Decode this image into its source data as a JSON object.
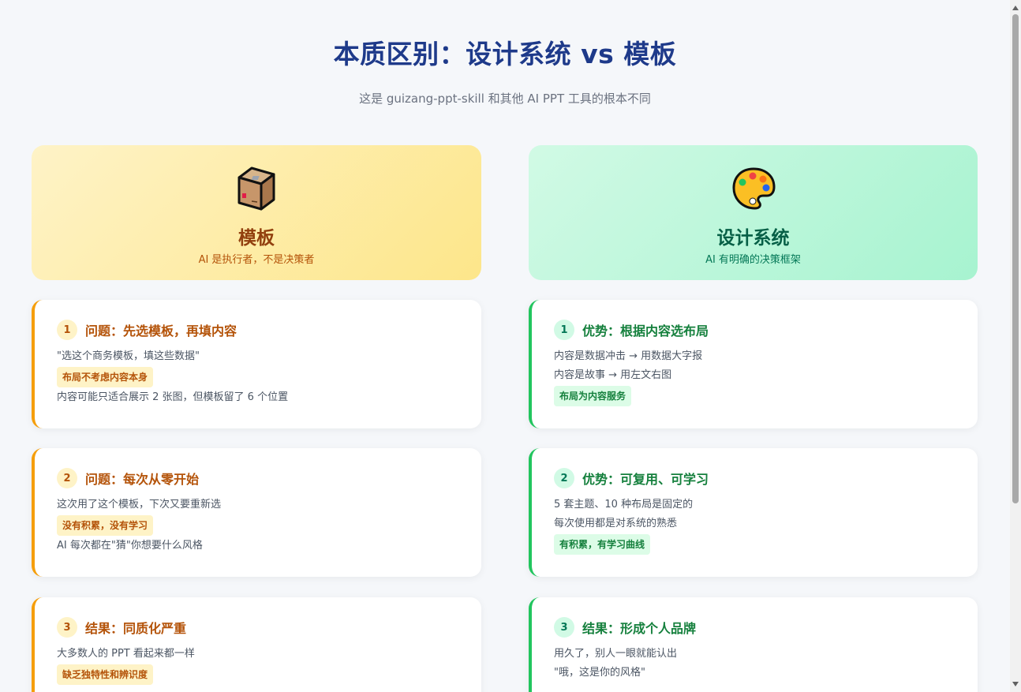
{
  "header": {
    "title": "本质区别：设计系统 vs 模板",
    "subtitle": "这是 guizang-ppt-skill 和其他 AI PPT 工具的根本不同"
  },
  "left_hero": {
    "icon": "package-box-icon",
    "name": "模板",
    "desc": "AI 是执行者，不是决策者"
  },
  "right_hero": {
    "icon": "artist-palette-icon",
    "name": "设计系统",
    "desc": "AI 有明确的决策框架"
  },
  "left_cards": [
    {
      "num": "1",
      "title": "问题：先选模板，再填内容",
      "line1": "\"选这个商务模板，填这些数据\"",
      "tag": "布局不考虑内容本身",
      "line2": "内容可能只适合展示 2 张图，但模板留了 6 个位置"
    },
    {
      "num": "2",
      "title": "问题：每次从零开始",
      "line1": "这次用了这个模板，下次又要重新选",
      "tag": "没有积累，没有学习",
      "line2": "AI 每次都在\"猜\"你想要什么风格"
    },
    {
      "num": "3",
      "title": "结果：同质化严重",
      "line1": "大多数人的 PPT 看起来都一样",
      "tag": "缺乏独特性和辨识度",
      "line2": ""
    }
  ],
  "right_cards": [
    {
      "num": "1",
      "title": "优势：根据内容选布局",
      "line1": "内容是数据冲击 → 用数据大字报",
      "line2": "内容是故事 → 用左文右图",
      "tag": "布局为内容服务"
    },
    {
      "num": "2",
      "title": "优势：可复用、可学习",
      "line1": "5 套主题、10 种布局是固定的",
      "line2": "每次使用都是对系统的熟悉",
      "tag": "有积累，有学习曲线"
    },
    {
      "num": "3",
      "title": "结果：形成个人品牌",
      "line1": "用久了，别人一眼就能认出",
      "line2": "\"哦，这是你的风格\"",
      "tag": ""
    }
  ]
}
